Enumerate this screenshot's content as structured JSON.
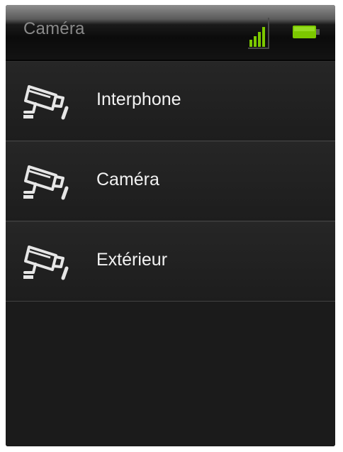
{
  "header": {
    "title": "Caméra",
    "signal_icon": "signal-strength-icon",
    "battery_icon": "battery-icon",
    "accent_color": "#7cc800"
  },
  "list": {
    "items": [
      {
        "label": "Interphone",
        "icon": "security-camera-icon"
      },
      {
        "label": "Caméra",
        "icon": "security-camera-icon"
      },
      {
        "label": "Extérieur",
        "icon": "security-camera-icon"
      }
    ]
  }
}
